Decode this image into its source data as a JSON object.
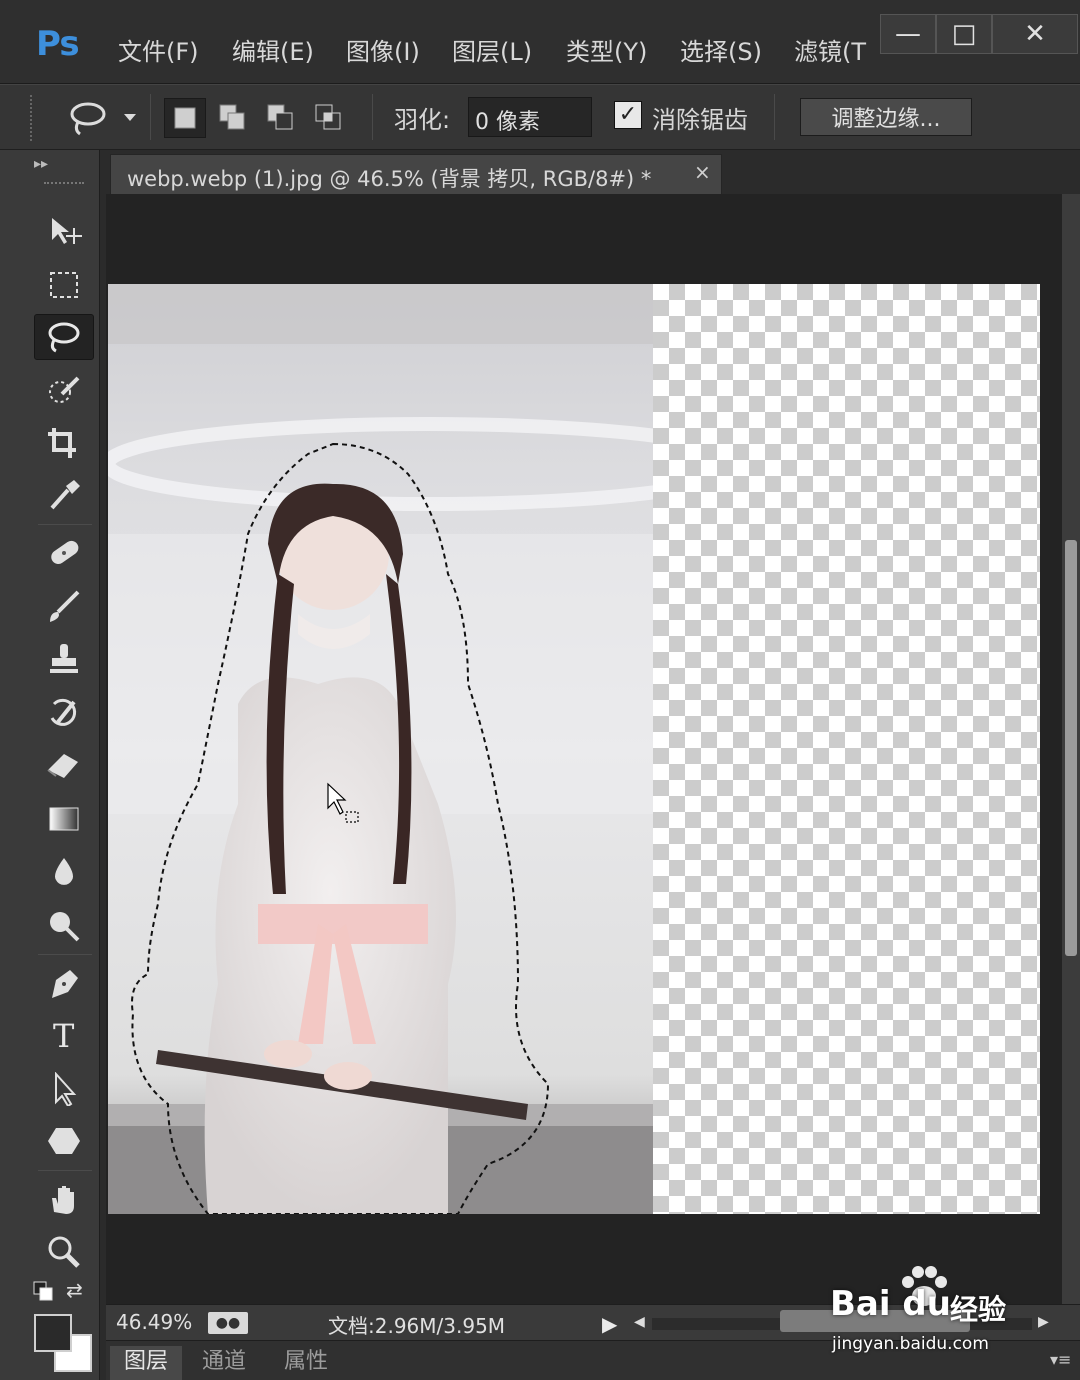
{
  "app": {
    "logo": "Ps",
    "menu": [
      "文件(F)",
      "编辑(E)",
      "图像(I)",
      "图层(L)",
      "类型(Y)",
      "选择(S)",
      "滤镜(T"
    ],
    "window_controls": {
      "minimize": "—",
      "maximize": "□",
      "close": "✕"
    }
  },
  "options": {
    "feather_label": "羽化:",
    "feather_value": "0 像素",
    "antialias_label": "消除锯齿",
    "antialias_checked": true,
    "refine_edge_label": "调整边缘..."
  },
  "tools": [
    "move-tool-icon",
    "marquee-tool-icon",
    "lasso-tool-icon",
    "quick-selection-tool-icon",
    "crop-tool-icon",
    "eyedropper-tool-icon",
    "healing-brush-tool-icon",
    "brush-tool-icon",
    "clone-stamp-tool-icon",
    "history-brush-tool-icon",
    "eraser-tool-icon",
    "gradient-tool-icon",
    "blur-tool-icon",
    "dodge-tool-icon",
    "pen-tool-icon",
    "type-tool-icon",
    "path-selection-tool-icon",
    "shape-tool-icon",
    "hand-tool-icon",
    "zoom-tool-icon"
  ],
  "active_tool": "lasso-tool-icon",
  "document": {
    "tab_title": "webp.webp (1).jpg @ 46.5% (背景 拷贝, RGB/8#) *",
    "close": "×"
  },
  "status": {
    "zoom": "46.49%",
    "doc_size": "文档:2.96M/3.95M"
  },
  "panels": {
    "tabs": [
      "图层",
      "通道",
      "属性"
    ],
    "active": "图层"
  },
  "colors": {
    "foreground": "#2a2a2a",
    "background": "#ffffff",
    "accent": "#3d8fdc"
  },
  "watermark": {
    "brand": "Bai du",
    "product": "经验",
    "url": "jingyan.baidu.com"
  }
}
